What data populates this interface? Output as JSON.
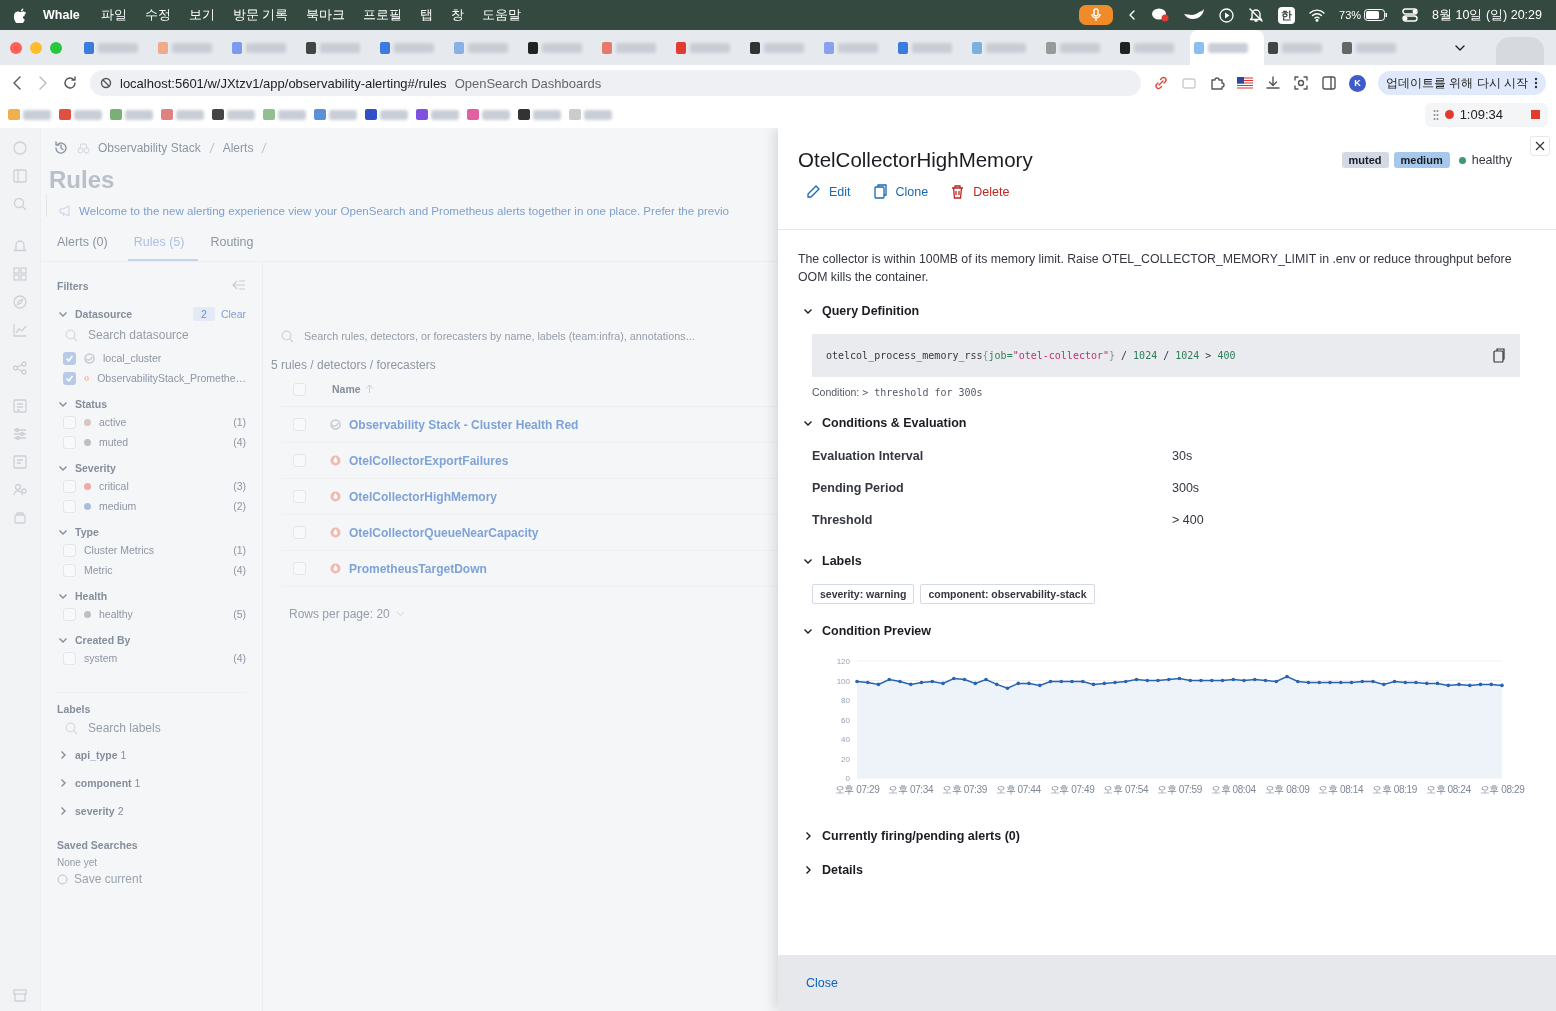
{
  "menubar": {
    "app": "Whale",
    "menus": [
      "파일",
      "수정",
      "보기",
      "방문 기록",
      "북마크",
      "프로필",
      "탭",
      "창",
      "도움말"
    ],
    "input_source": "한",
    "battery": "73%",
    "clock": "8월 10일 (일) 20:29"
  },
  "browser": {
    "tabs": [
      {
        "selected": false
      },
      {
        "selected": false
      },
      {
        "selected": false
      },
      {
        "selected": false
      },
      {
        "selected": false
      },
      {
        "selected": false
      },
      {
        "selected": false
      },
      {
        "selected": false
      },
      {
        "selected": false
      },
      {
        "selected": false
      },
      {
        "selected": false
      },
      {
        "selected": false
      },
      {
        "selected": false
      },
      {
        "selected": false
      },
      {
        "selected": false
      },
      {
        "selected": true
      },
      {
        "selected": false
      },
      {
        "selected": false
      }
    ],
    "url": "localhost:5601/w/JXtzv1/app/observability-alerting#/rules",
    "page_title": "OpenSearch Dashboards",
    "update_button": "업데이트를 위해 다시 시작",
    "profile_initial": "K",
    "recording_time": "1:09:34"
  },
  "breadcrumbs": [
    "Observability Stack",
    "Alerts"
  ],
  "page_title": "Rules",
  "banner": "Welcome to the new alerting experience view your OpenSearch and Prometheus alerts together in one place. Prefer the previo",
  "tabs": [
    {
      "label": "Alerts (0)",
      "selected": false
    },
    {
      "label": "Rules (5)",
      "selected": true
    },
    {
      "label": "Routing",
      "selected": false
    }
  ],
  "filters": {
    "title": "Filters",
    "groups": [
      {
        "title": "Datasource",
        "expanded": true,
        "count": "2",
        "clear": "Clear",
        "search_placeholder": "Search datasource",
        "options": [
          {
            "label": "local_cluster",
            "kind": "cluster",
            "checked": true
          },
          {
            "label": "ObservabilityStack_Promethe…",
            "kind": "prometheus",
            "checked": true
          }
        ]
      },
      {
        "title": "Status",
        "expanded": true,
        "options": [
          {
            "label": "active",
            "kind": "dot",
            "color": "#dcc4c4",
            "count": "(1)",
            "checked": false
          },
          {
            "label": "muted",
            "kind": "dot",
            "color": "#bcc0c6",
            "count": "(4)",
            "checked": false
          }
        ]
      },
      {
        "title": "Severity",
        "expanded": true,
        "options": [
          {
            "label": "critical",
            "kind": "dot",
            "color": "#f0aaa8",
            "count": "(3)",
            "checked": false
          },
          {
            "label": "medium",
            "kind": "dot",
            "color": "#a9bfe0",
            "count": "(2)",
            "checked": false
          }
        ]
      },
      {
        "title": "Type",
        "expanded": true,
        "options": [
          {
            "label": "Cluster Metrics",
            "kind": "plain",
            "count": "(1)",
            "checked": false
          },
          {
            "label": "Metric",
            "kind": "plain",
            "count": "(4)",
            "checked": false
          }
        ]
      },
      {
        "title": "Health",
        "expanded": true,
        "options": [
          {
            "label": "healthy",
            "kind": "dot",
            "color": "#bcc0c6",
            "count": "(5)",
            "checked": false
          }
        ]
      },
      {
        "title": "Created By",
        "expanded": true,
        "options": [
          {
            "label": "system",
            "kind": "plain",
            "count": "(4)",
            "checked": false
          }
        ]
      }
    ],
    "labels": {
      "title": "Labels",
      "search_placeholder": "Search labels",
      "items": [
        {
          "name": "api_type",
          "count": "1",
          "expanded": false
        },
        {
          "name": "component",
          "count": "1",
          "expanded": false
        },
        {
          "name": "severity",
          "count": "2",
          "expanded": false
        }
      ]
    },
    "saved": {
      "title": "Saved Searches",
      "empty": "None yet",
      "action": "Save current"
    }
  },
  "rules": {
    "search_placeholder": "Search rules, detectors, or forecasters by name, labels (team:infra), annotations...",
    "count": "5 rules / detectors / forecasters",
    "name_column": "Name",
    "select_all_checked": false,
    "rows": [
      {
        "name": "Observability Stack - Cluster Health Red",
        "kind": "cluster",
        "checked": false
      },
      {
        "name": "OtelCollectorExportFailures",
        "kind": "prometheus",
        "checked": false
      },
      {
        "name": "OtelCollectorHighMemory",
        "kind": "prometheus",
        "checked": false
      },
      {
        "name": "OtelCollectorQueueNearCapacity",
        "kind": "prometheus",
        "checked": false
      },
      {
        "name": "PrometheusTargetDown",
        "kind": "prometheus",
        "checked": false
      }
    ],
    "rows_per_page": "Rows per page: 20"
  },
  "flyout": {
    "title": "OtelCollectorHighMemory",
    "badges": [
      {
        "label": "muted",
        "color": "#d3dae6"
      },
      {
        "label": "medium",
        "color": "#a6c8ec"
      }
    ],
    "health": {
      "label": "healthy",
      "color": "#3d9970"
    },
    "actions": [
      {
        "label": "Edit",
        "kind": "edit"
      },
      {
        "label": "Clone",
        "kind": "clone"
      },
      {
        "label": "Delete",
        "kind": "delete"
      }
    ],
    "description": "The collector is within 100MB of its memory limit. Raise OTEL_COLLECTOR_MEMORY_LIMIT in .env or reduce throughput before OOM kills the container.",
    "sections": [
      {
        "kind": "query",
        "title": "Query Definition",
        "expanded": true,
        "code": [
          {
            "text": "otelcol_process_memory_rss",
            "kind": "name"
          },
          {
            "text": "{",
            "kind": "punct"
          },
          {
            "text": "job=",
            "kind": "key"
          },
          {
            "text": "\"otel-collector\"",
            "kind": "string"
          },
          {
            "text": "}",
            "kind": "punct"
          },
          {
            "text": " / ",
            "kind": "op"
          },
          {
            "text": "1024",
            "kind": "number"
          },
          {
            "text": " / ",
            "kind": "op"
          },
          {
            "text": "1024",
            "kind": "number"
          },
          {
            "text": " > ",
            "kind": "op"
          },
          {
            "text": "400",
            "kind": "number"
          }
        ],
        "condition_label": "Condition:",
        "condition_value": "> threshold for 300s"
      },
      {
        "kind": "conditions",
        "title": "Conditions & Evaluation",
        "expanded": true,
        "rows": [
          {
            "label": "Evaluation Interval",
            "value": "30s"
          },
          {
            "label": "Pending Period",
            "value": "300s"
          },
          {
            "label": "Threshold",
            "value": "> 400"
          }
        ]
      },
      {
        "kind": "labels",
        "title": "Labels",
        "expanded": true,
        "tags": [
          "severity: warning",
          "component: observability-stack"
        ]
      },
      {
        "kind": "preview",
        "title": "Condition Preview",
        "expanded": true,
        "chart_data": {
          "type": "area",
          "ylim": [
            0,
            120
          ],
          "yticks": [
            0,
            20,
            40,
            60,
            80,
            100,
            120
          ],
          "categories": [
            "오후 07:29",
            null,
            null,
            null,
            null,
            "오후 07:34",
            null,
            null,
            null,
            null,
            "오후 07:39",
            null,
            null,
            null,
            null,
            "오후 07:44",
            null,
            null,
            null,
            null,
            "오후 07:49",
            null,
            null,
            null,
            null,
            "오후 07:54",
            null,
            null,
            null,
            null,
            "오후 07:59",
            null,
            null,
            null,
            null,
            "오후 08:04",
            null,
            null,
            null,
            null,
            "오후 08:09",
            null,
            null,
            null,
            null,
            "오후 08:14",
            null,
            null,
            null,
            null,
            "오후 08:19",
            null,
            null,
            null,
            null,
            "오후 08:24",
            null,
            null,
            null,
            null,
            "오후 08:29"
          ],
          "series": [
            {
              "color": "#2a64b0",
              "values": [
                99,
                98,
                96,
                101,
                99,
                96,
                98,
                99,
                97,
                102,
                101,
                97,
                101,
                96,
                92,
                97,
                97,
                95,
                99,
                99,
                99,
                99,
                96,
                97,
                98,
                99,
                101,
                100,
                100,
                101,
                102,
                100,
                100,
                100,
                100,
                101,
                100,
                101,
                100,
                99,
                104,
                99,
                98,
                98,
                98,
                98,
                98,
                99,
                99,
                96,
                99,
                98,
                98,
                97,
                97,
                95,
                96,
                95,
                96,
                96,
                95
              ]
            }
          ]
        }
      },
      {
        "kind": "plain",
        "title": "Currently firing/pending alerts (0)",
        "expanded": false
      },
      {
        "kind": "plain",
        "title": "Details",
        "expanded": false
      }
    ],
    "footer_close": "Close"
  }
}
